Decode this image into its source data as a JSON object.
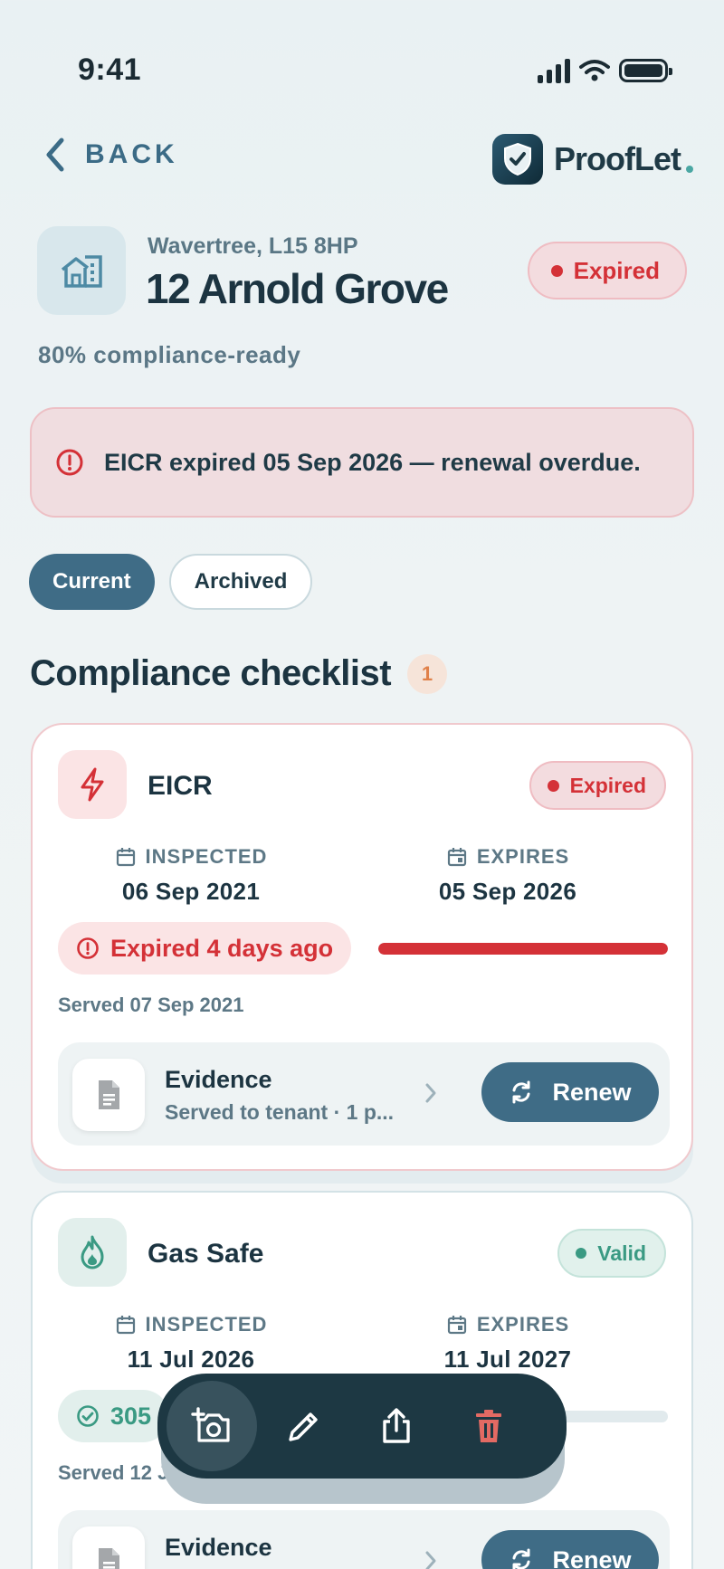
{
  "status_bar": {
    "time": "9:41"
  },
  "header": {
    "back_label": "BACK",
    "brand": "ProofLet"
  },
  "property": {
    "area": "Wavertree, L15 8HP",
    "title": "12 Arnold Grove",
    "status": "Expired",
    "readiness": "80% compliance-ready"
  },
  "alert": {
    "text": "EICR expired 05 Sep 2026 — renewal overdue."
  },
  "tabs": [
    {
      "label": "Current",
      "active": true
    },
    {
      "label": "Archived",
      "active": false
    }
  ],
  "checklist": {
    "title": "Compliance checklist",
    "count": "1",
    "items": [
      {
        "title": "EICR",
        "status": "Expired",
        "inspected_label": "INSPECTED",
        "inspected": "06 Sep 2021",
        "expires_label": "EXPIRES",
        "expires": "05 Sep 2026",
        "countdown": "Expired 4 days ago",
        "progress": 1.0,
        "served": "Served 07 Sep 2021",
        "evidence_title": "Evidence",
        "evidence_sub": "Served to tenant · 1 p...",
        "action": "Renew"
      },
      {
        "title": "Gas Safe",
        "status": "Valid",
        "inspected_label": "INSPECTED",
        "inspected": "11 Jul 2026",
        "expires_label": "EXPIRES",
        "expires": "11 Jul 2027",
        "countdown": "305",
        "progress": 0.16,
        "served": "Served 12 Ju",
        "evidence_title": "Evidence",
        "action": "Renew"
      }
    ]
  },
  "action_bar": {
    "icons": [
      "add-photo-icon",
      "edit-icon",
      "share-icon",
      "delete-icon"
    ]
  },
  "colors": {
    "accent": "#3f6c86",
    "danger": "#d43137",
    "success": "#3a9a83",
    "ink": "#1c3441",
    "bar": "#1d3843"
  }
}
